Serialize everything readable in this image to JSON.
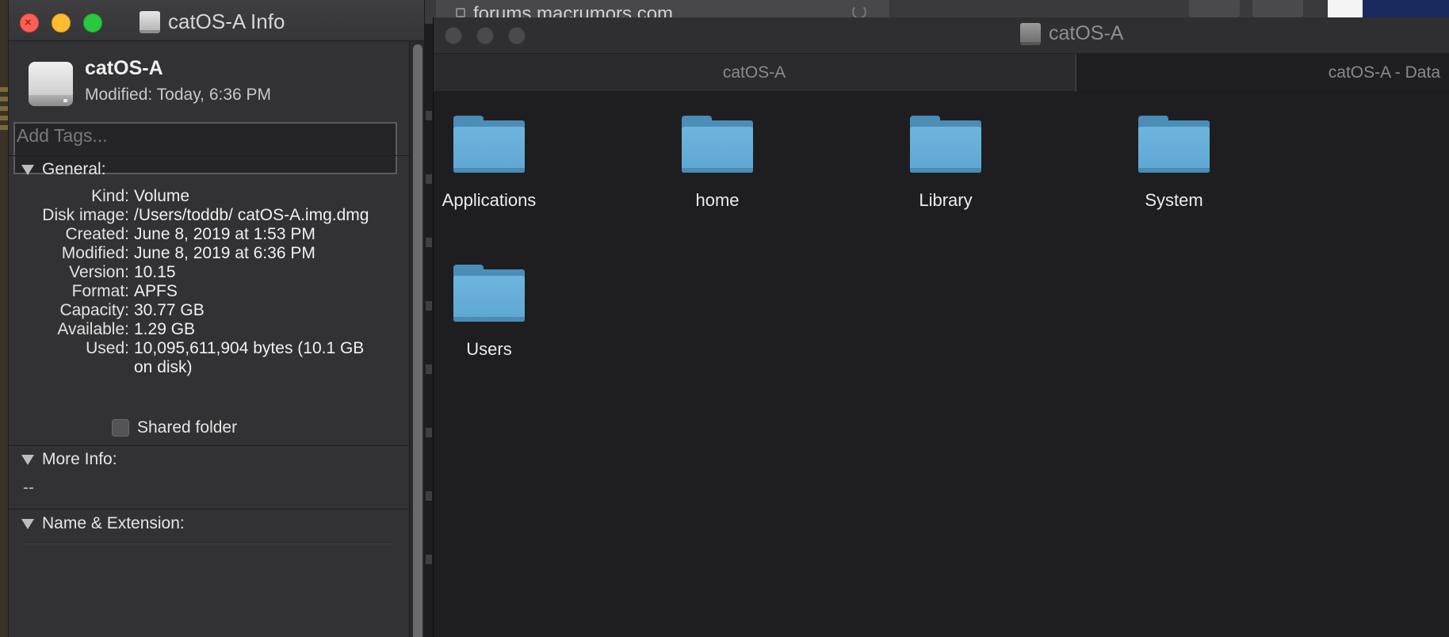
{
  "background": {
    "url": "forums.macrumors.com"
  },
  "info_window": {
    "title": "catOS-A Info",
    "volume_name": "catOS-A",
    "modified_summary": "Modified:  Today, 6:36 PM",
    "tags_placeholder": "Add Tags...",
    "general": {
      "header": "General:",
      "rows": [
        {
          "k": "Kind:",
          "v": "Volume"
        },
        {
          "k": "Disk image:",
          "v": "/Users/toddb/ catOS-A.img.dmg"
        },
        {
          "k": "Created:",
          "v": "June 8, 2019 at 1:53 PM"
        },
        {
          "k": "Modified:",
          "v": "June 8, 2019 at 6:36 PM"
        },
        {
          "k": "Version:",
          "v": "10.15"
        },
        {
          "k": "Format:",
          "v": "APFS"
        },
        {
          "k": "Capacity:",
          "v": "30.77 GB"
        },
        {
          "k": "Available:",
          "v": "1.29 GB"
        },
        {
          "k": "Used:",
          "v": "10,095,611,904 bytes (10.1 GB on disk)"
        }
      ],
      "shared_folder_label": "Shared folder",
      "shared_folder_checked": false
    },
    "more_info": {
      "header": "More Info:",
      "value": "--"
    },
    "name_extension": {
      "header": "Name & Extension:"
    }
  },
  "finder_window": {
    "title": "catOS-A",
    "tabs": [
      {
        "label": "catOS-A"
      },
      {
        "label": "catOS-A - Data"
      }
    ],
    "items": [
      {
        "label": "Applications"
      },
      {
        "label": "home"
      },
      {
        "label": "Library"
      },
      {
        "label": "System"
      },
      {
        "label": "Users"
      }
    ],
    "folder_color": "#6db5de"
  }
}
